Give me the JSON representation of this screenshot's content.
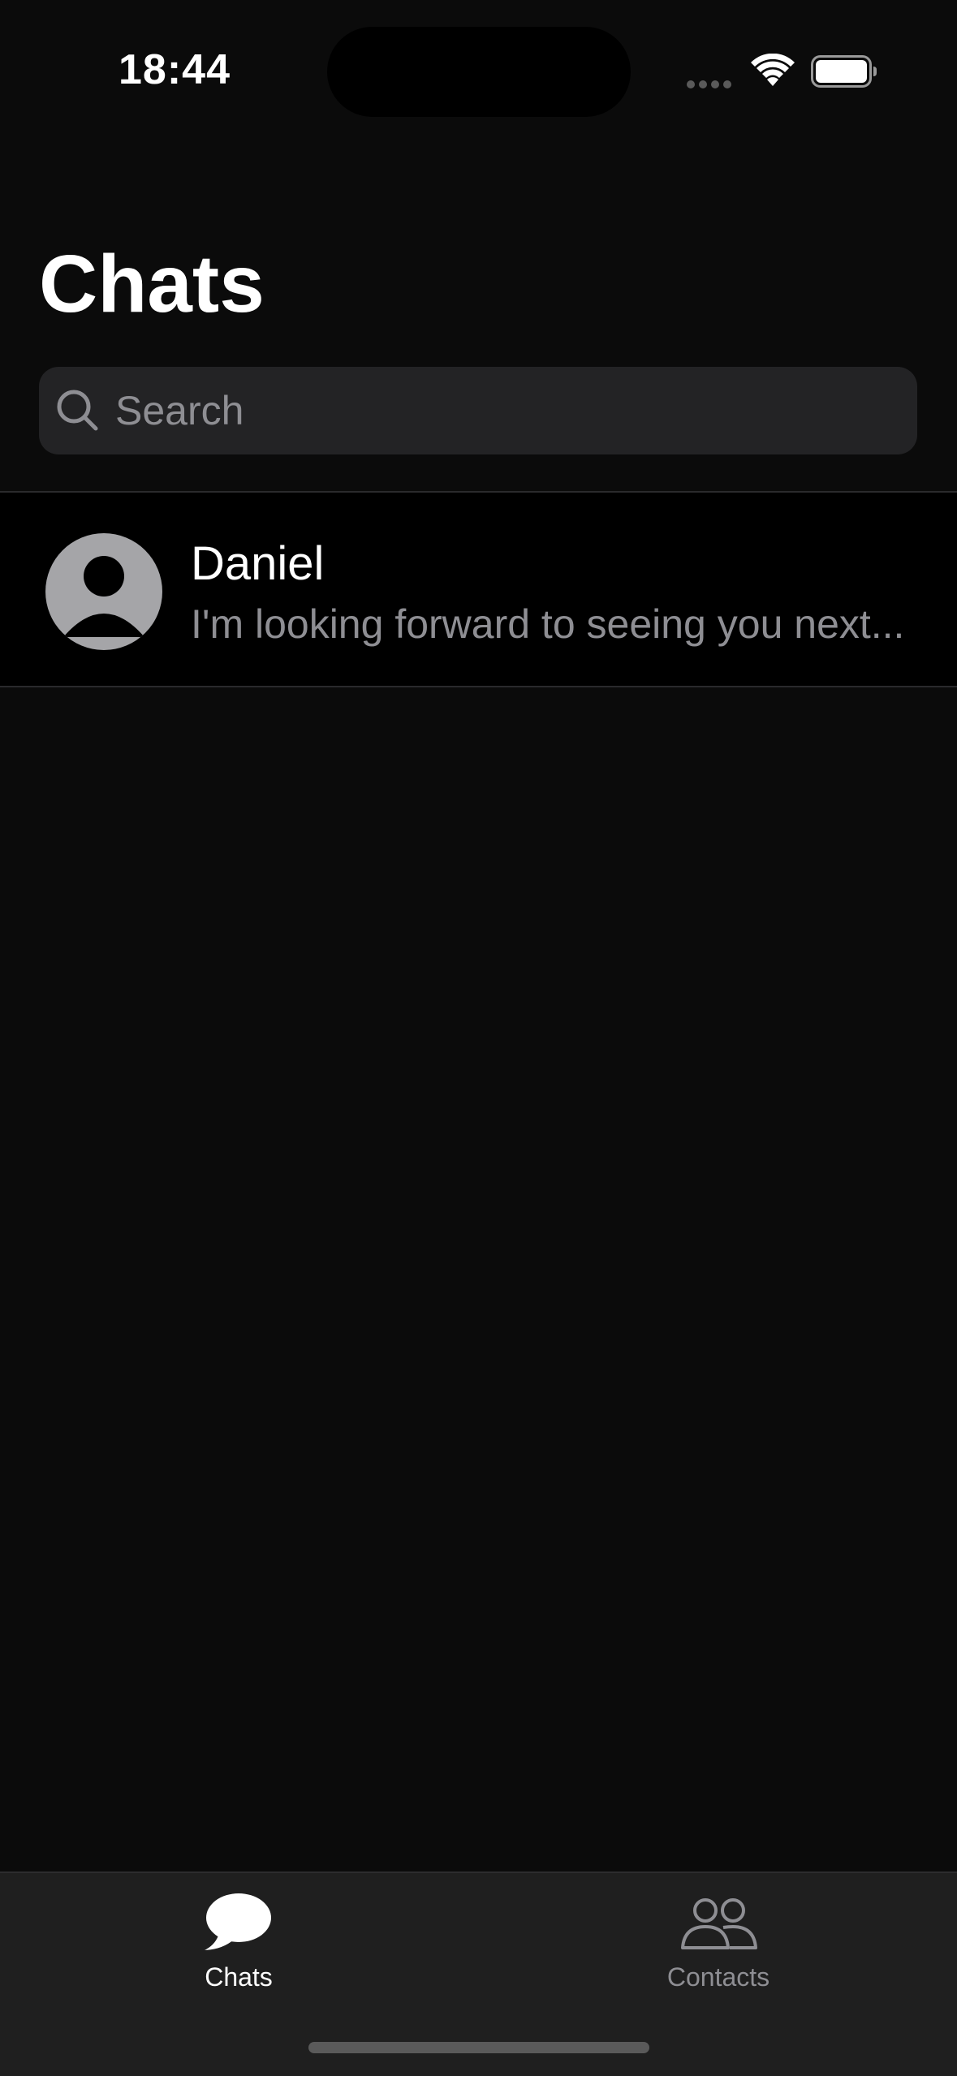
{
  "status_bar": {
    "time": "18:44"
  },
  "header": {
    "title": "Chats"
  },
  "search": {
    "placeholder": "Search",
    "value": ""
  },
  "chats": [
    {
      "name": "Daniel",
      "preview": "I'm looking forward to seeing you next...",
      "avatar_icon": "person-placeholder-icon"
    }
  ],
  "tab_bar": {
    "tabs": [
      {
        "label": "Chats",
        "icon": "chat-bubble-icon",
        "selected": true
      },
      {
        "label": "Contacts",
        "icon": "people-icon",
        "selected": false
      }
    ]
  },
  "colors": {
    "background": "#0b0b0b",
    "row_background": "#000000",
    "search_background": "#232325",
    "tab_bar_background": "#1f1f1f",
    "secondary_text": "#8e8e93",
    "primary_text": "#ffffff"
  }
}
